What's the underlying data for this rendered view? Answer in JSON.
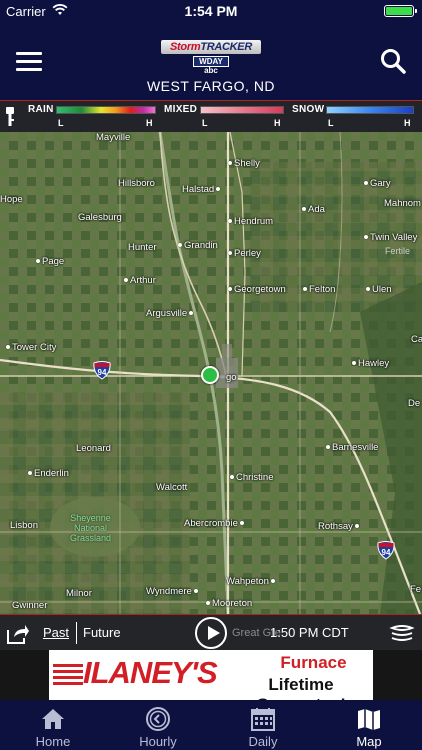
{
  "status_bar": {
    "carrier": "Carrier",
    "time": "1:54 PM",
    "battery_color": "#3ddc4a"
  },
  "header": {
    "logo_text_storm": "Storm",
    "logo_text_tracker": "TRACKER",
    "logo_sub": "WDAY abc",
    "location": "WEST FARGO, ND",
    "background": "#0d1140"
  },
  "legend": {
    "rain": {
      "label": "RAIN",
      "low": "L",
      "high": "H"
    },
    "mixed": {
      "label": "MIXED",
      "low": "L",
      "high": "H"
    },
    "snow": {
      "label": "SNOW",
      "low": "L",
      "high": "H"
    }
  },
  "map": {
    "towns": [
      "Mayville",
      "Shelly",
      "Hillsboro",
      "Halstad",
      "Gary",
      "Hope",
      "Galesburg",
      "Hendrum",
      "Ada",
      "Mahnom",
      "Twin Valley",
      "Hunter",
      "Grandin",
      "Perley",
      "Page",
      "Arthur",
      "Georgetown",
      "Felton",
      "Ulen",
      "Argusville",
      "Tower City",
      "Hawley",
      "Leonard",
      "Barnesville",
      "Enderlin",
      "Christine",
      "Walcott",
      "Abercrombie",
      "Lisbon",
      "Rothsay",
      "Milnor",
      "Wyndmere",
      "Wahpeton",
      "Gwinner",
      "Mooreton"
    ],
    "grassland_label": "Sheyenne\nNational\nGrassland",
    "fertile_label": "Fertile",
    "city_partial": "go",
    "right_edge_partial": [
      "Ca",
      "De",
      "Fe"
    ],
    "interstate": "94"
  },
  "playback": {
    "past": "Past",
    "future": "Future",
    "faded_text": "Great Gre",
    "timestamp": "1:50 PM CDT"
  },
  "ad": {
    "brand": "ILANEY'S",
    "line1": "Furnace",
    "line2": "Lifetime Guarantee!"
  },
  "tabs": [
    {
      "label": "Home",
      "icon": "home-icon"
    },
    {
      "label": "Hourly",
      "icon": "clock-icon"
    },
    {
      "label": "Daily",
      "icon": "calendar-icon"
    },
    {
      "label": "Map",
      "icon": "map-icon",
      "active": true
    }
  ]
}
